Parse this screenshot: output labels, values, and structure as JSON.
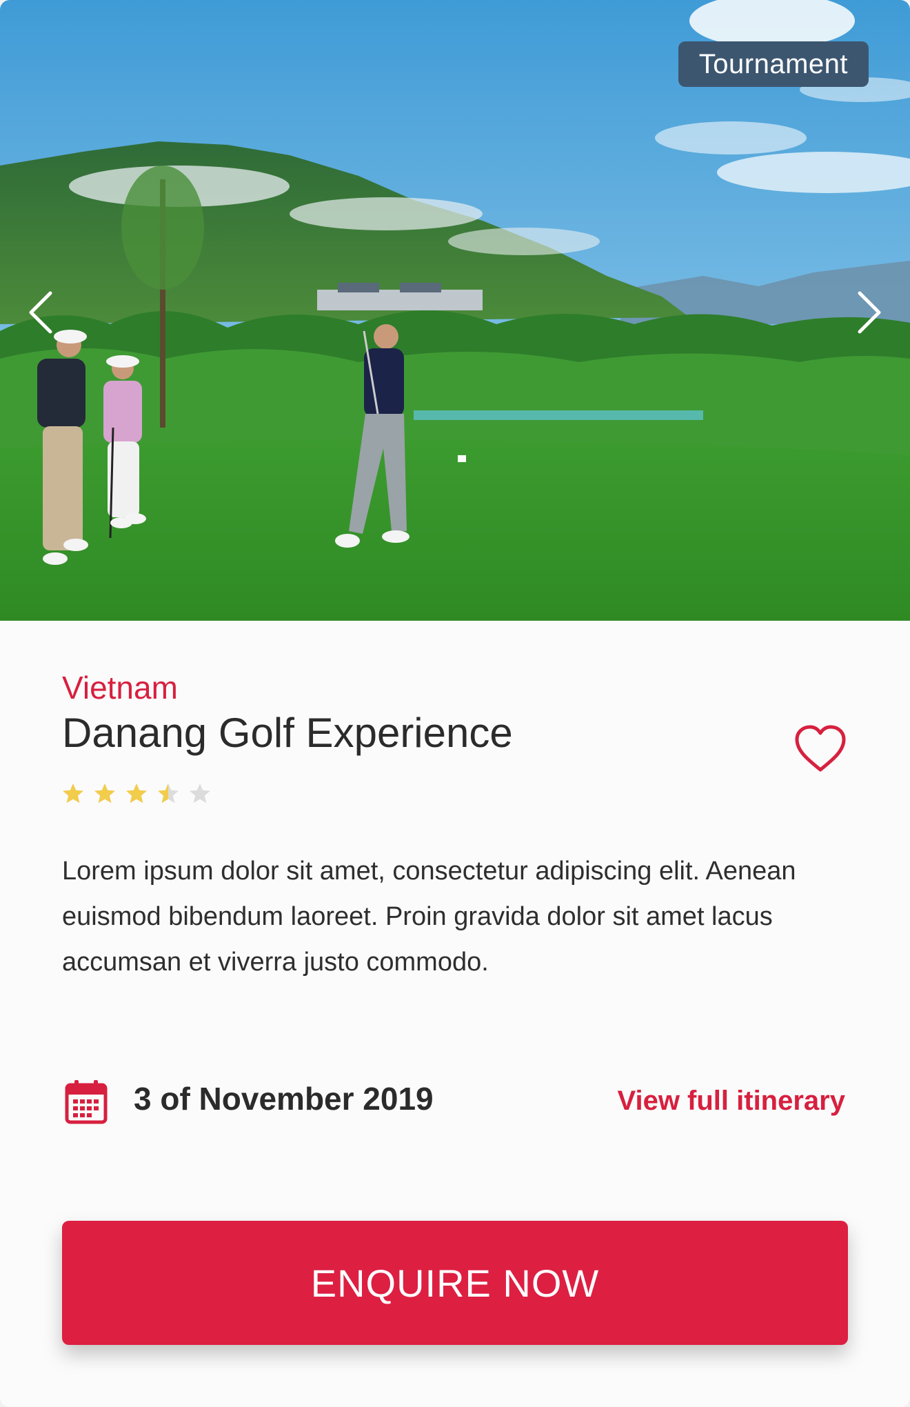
{
  "hero": {
    "badge": "Tournament",
    "prev_icon": "chevron-left-icon",
    "next_icon": "chevron-right-icon"
  },
  "trip": {
    "country": "Vietnam",
    "title": "Danang Golf Experience",
    "rating": 3.5,
    "rating_max": 5,
    "description": "Lorem ipsum dolor sit amet, consectetur adipiscing elit. Aenean euismod bibendum laoreet. Proin gravida dolor sit amet lacus accumsan et viverra justo commodo.",
    "date": "3 of November 2019",
    "itinerary_link": "View full itinerary",
    "cta_label": "ENQUIRE NOW"
  },
  "colors": {
    "accent": "#d7203f",
    "star_filled": "#f2cc4b",
    "star_empty": "#dcdcdc",
    "badge_bg": "#3d5670"
  }
}
